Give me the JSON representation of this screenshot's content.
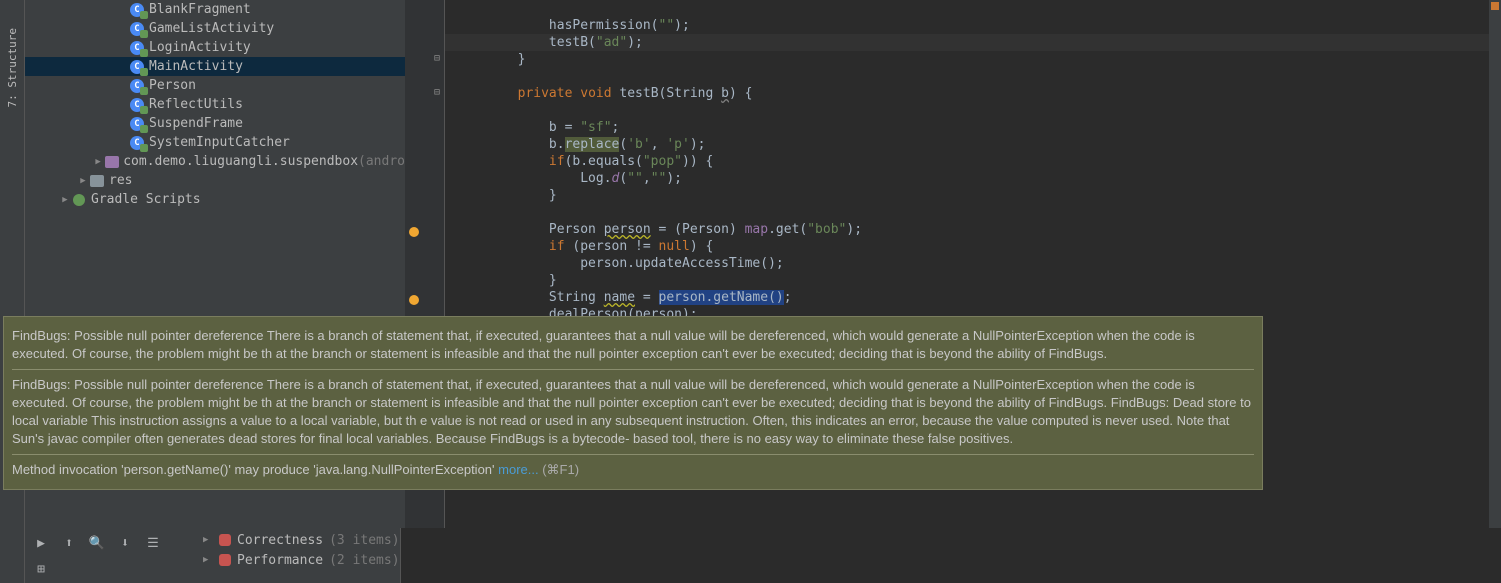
{
  "sidebar": {
    "structure_label": "7: Structure"
  },
  "tree": {
    "items": [
      {
        "indent": 100,
        "icon": "class",
        "label": "BlankFragment"
      },
      {
        "indent": 100,
        "icon": "class",
        "label": "GameListActivity"
      },
      {
        "indent": 100,
        "icon": "class",
        "label": "LoginActivity"
      },
      {
        "indent": 100,
        "icon": "class",
        "label": "MainActivity",
        "selected": true
      },
      {
        "indent": 100,
        "icon": "class",
        "label": "Person"
      },
      {
        "indent": 100,
        "icon": "class",
        "label": "ReflectUtils"
      },
      {
        "indent": 100,
        "icon": "class",
        "label": "SuspendFrame"
      },
      {
        "indent": 100,
        "icon": "class",
        "label": "SystemInputCatcher"
      },
      {
        "indent": 66,
        "arrow": "▶",
        "icon": "pkg",
        "label": "com.demo.liuguangli.suspendbox",
        "dim_suffix": " (andro"
      },
      {
        "indent": 48,
        "arrow": "▶",
        "icon": "folder",
        "label": "res"
      },
      {
        "indent": 30,
        "arrow": "▶",
        "icon": "gradle",
        "label": "Gradle Scripts"
      }
    ]
  },
  "code": {
    "lines": [
      "",
      "            hasPermission(\"\");",
      "            testB(\"ad\");",
      "        }",
      "",
      "        private void testB(String b) {",
      "",
      "            b = \"sf\";",
      "            b.replace('b', 'p');",
      "            if(b.equals(\"pop\")) {",
      "                Log.d(\"\",\"\");",
      "            }",
      "",
      "            Person person = (Person) map.get(\"bob\");",
      "            if (person != null) {",
      "                person.updateAccessTime();",
      "            }",
      "            String name = person.getName();",
      "            dealPerson(person);"
    ]
  },
  "tooltip": {
    "msg1": "FindBugs: Possible null pointer dereference There is a branch of statement that, if executed, guarantees that a null value will be dereferenced, which would generate a NullPointerException when the code is executed. Of course, the problem might be th at the branch or statement is infeasible and that the null pointer exception can't ever be executed; deciding that is beyond the ability of FindBugs.",
    "msg2": "FindBugs: Possible null pointer dereference There is a branch of statement that, if executed, guarantees that a null value will be dereferenced, which would generate a NullPointerException when the code is executed. Of course, the problem might be th at the branch or statement is infeasible and that the null pointer exception can't ever be executed; deciding that is beyond the ability of FindBugs. FindBugs: Dead store to local variable This instruction assigns a value to a local variable, but th e value is not read or used in any subsequent instruction. Often, this indicates an error, because the value computed is never used. Note that Sun's javac compiler often generates dead stores for final local variables. Because FindBugs is a bytecode- based tool, there is no easy way to eliminate these false positives.",
    "msg3_pre": "Method invocation 'person.getName()' may produce 'java.lang.NullPointerException' ",
    "msg3_link": "more...",
    "msg3_shortcut": " (⌘F1)"
  },
  "findbugs": {
    "items": [
      {
        "label": "Correctness",
        "count": "(3 items)"
      },
      {
        "label": "Performance",
        "count": "(2 items)"
      }
    ]
  }
}
